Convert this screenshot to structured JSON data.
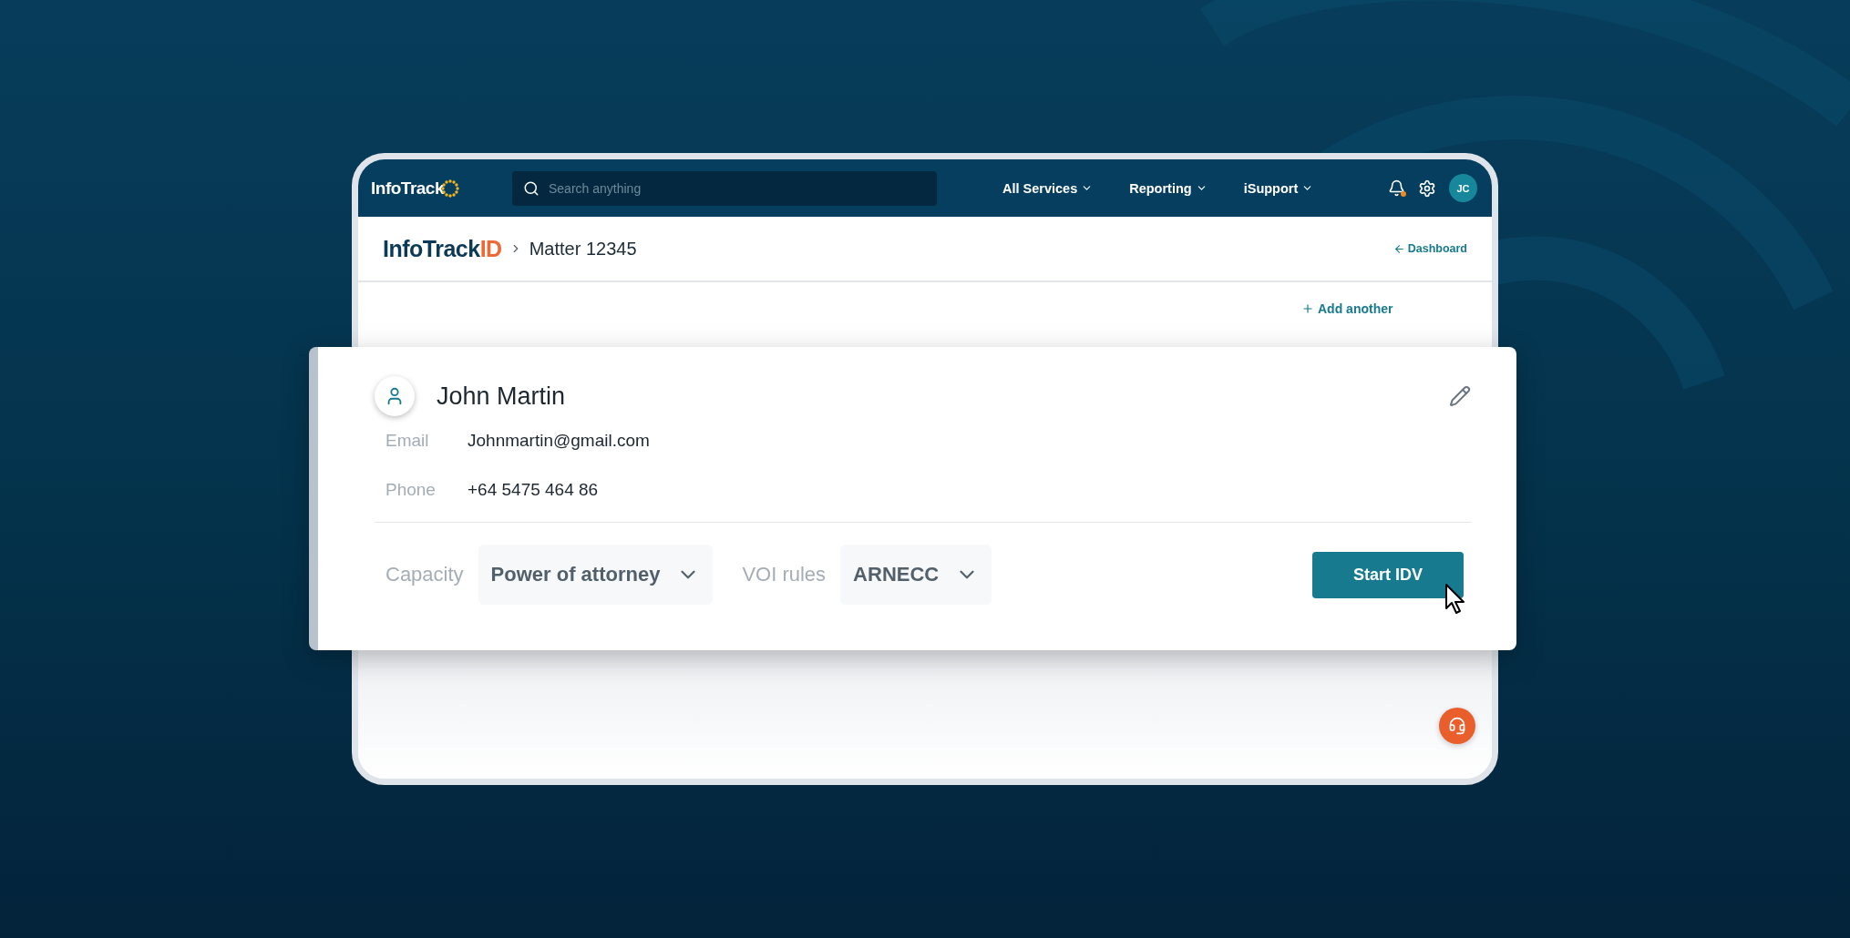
{
  "top_bar": {
    "logo": "InfoTrack",
    "search": {
      "placeholder": "Search anything"
    },
    "menus": [
      {
        "label": "All Services"
      },
      {
        "label": "Reporting"
      },
      {
        "label": "iSupport"
      }
    ],
    "notification_badge": true,
    "avatar_initials": "JC"
  },
  "breadcrumb": {
    "product": {
      "name": "InfoTrack",
      "suffix": "ID"
    },
    "current": "Matter 12345",
    "back_link": "Dashboard"
  },
  "add_another": "Add another",
  "person_card": {
    "name": "John Martin",
    "fields": [
      {
        "label": "Email",
        "value": "Johnmartin@gmail.com"
      },
      {
        "label": "Phone",
        "value": "+64 5475 464 86"
      }
    ],
    "selects": [
      {
        "label": "Capacity",
        "value": "Power of attorney"
      },
      {
        "label": "VOI rules",
        "value": "ARNECC"
      }
    ],
    "action": "Start IDV"
  }
}
